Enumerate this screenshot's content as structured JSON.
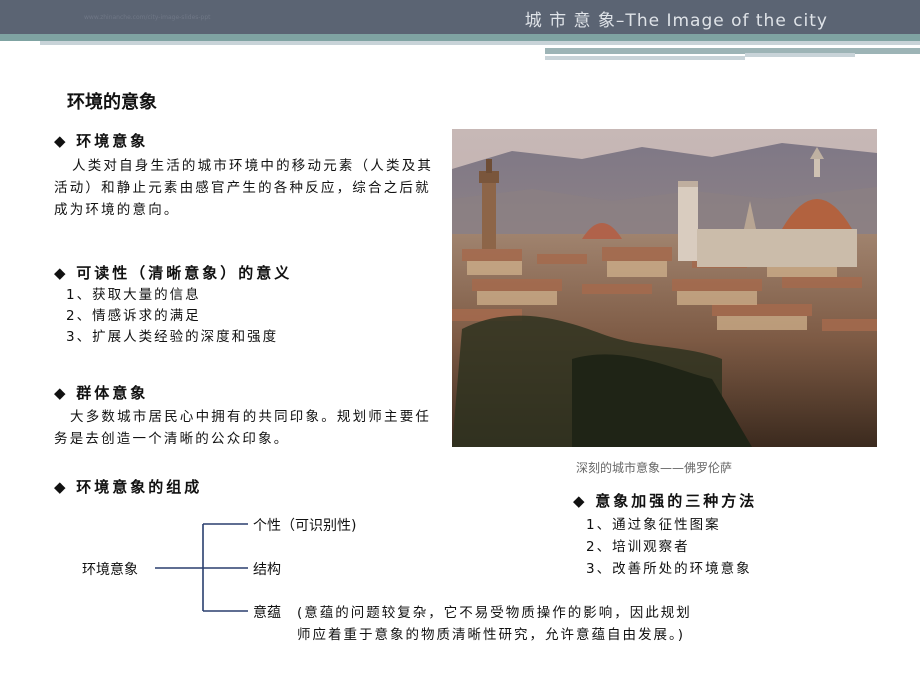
{
  "header": {
    "title": "城 市 意 象–The Image of the city",
    "faint_text": "www.zhinanche.com/city-image-slides-ppt",
    "colors": {
      "bar": "#5b6473",
      "teal": "#7fa3a2",
      "light": "#c8d3d8"
    }
  },
  "page_title": "环境的意象",
  "sections": {
    "env_image": {
      "marker": "◆",
      "heading": "环境意象",
      "body": "人类对自身生活的城市环境中的移动元素（人类及其活动）和静止元素由感官产生的各种反应，综合之后就成为环境的意向。"
    },
    "readability": {
      "marker": "◆",
      "heading": "可读性（清晰意象）的意义",
      "items": [
        "1、获取大量的信息",
        "2、情感诉求的满足",
        "3、扩展人类经验的深度和强度"
      ]
    },
    "group_image": {
      "marker": "◆",
      "heading": "群体意象",
      "body": "大多数城市居民心中拥有的共同印象。规划师主要任务是去创造一个清晰的公众印象。"
    },
    "composition": {
      "marker": "◆",
      "heading": "环境意象的组成"
    },
    "methods": {
      "marker": "◆",
      "heading": "意象加强的三种方法",
      "items": [
        "1、通过象征性图案",
        "2、培训观察者",
        "3、改善所处的环境意象"
      ]
    }
  },
  "photo": {
    "subject": "florence-cityscape-photo",
    "caption": "深刻的城市意象——佛罗伦萨"
  },
  "tree": {
    "root": "环境意象",
    "branches": [
      "个性（可识别性)",
      "结构",
      "意蕴"
    ],
    "note_line1": "(意蕴的问题较复杂，它不易受物质操作的影响，因此规划",
    "note_line2": "师应着重于意象的物质清晰性研究，允许意蕴自由发展。)"
  }
}
